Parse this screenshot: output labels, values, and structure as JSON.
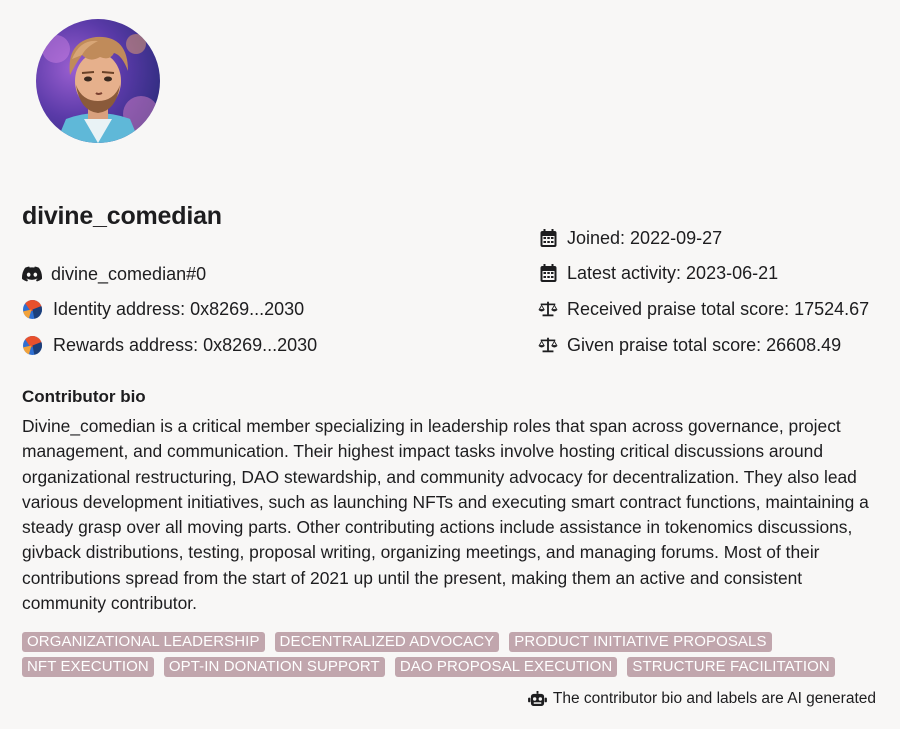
{
  "profile": {
    "username": "divine_comedian",
    "discord": "divine_comedian#0",
    "identity_address": "Identity address: 0x8269...2030",
    "rewards_address": "Rewards address: 0x8269...2030",
    "joined": "Joined: 2022-09-27",
    "latest_activity": "Latest activity: 2023-06-21",
    "received_score": "Received praise total score: 17524.67",
    "given_score": "Given praise total score: 26608.49"
  },
  "bio": {
    "title": "Contributor bio",
    "text": "Divine_comedian is a critical member specializing in leadership roles that span across governance, project management, and communication. Their highest impact tasks involve hosting critical discussions around organizational restructuring, DAO stewardship, and community advocacy for decentralization. They also lead various development initiatives, such as launching NFTs and executing smart contract functions, maintaining a steady grasp over all moving parts. Other contributing actions include assistance in tokenomics discussions, givback distributions, testing, proposal writing, organizing meetings, and managing forums. Most of their contributions spread from the start of 2021 up until the present, making them an active and consistent community contributor."
  },
  "tags": [
    "ORGANIZATIONAL LEADERSHIP",
    "DECENTRALIZED ADVOCACY",
    "PRODUCT INITIATIVE PROPOSALS",
    "NFT EXECUTION",
    "OPT-IN DONATION SUPPORT",
    "DAO PROPOSAL EXECUTION",
    "STRUCTURE FACILITATION"
  ],
  "ai_note": "The contributor bio and labels are AI generated",
  "icons": {
    "discord": "discord-icon",
    "identity": "jazzicon-identity-icon",
    "rewards": "jazzicon-rewards-icon",
    "calendar": "calendar-icon",
    "scale": "scale-icon",
    "robot": "robot-icon"
  },
  "colors": {
    "background": "#f8f7f6",
    "tag_bg": "#c1a6ad",
    "text": "#1d1d1f"
  }
}
